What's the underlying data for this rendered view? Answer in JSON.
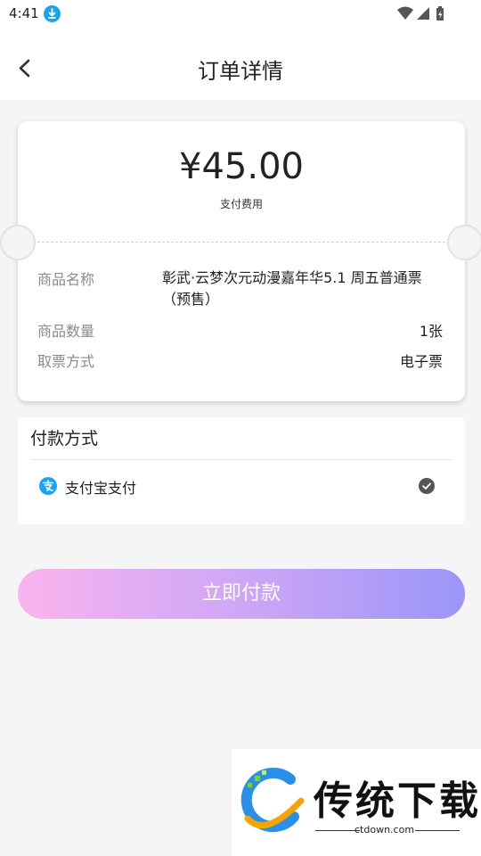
{
  "status_bar": {
    "time": "4:41"
  },
  "header": {
    "title": "订单详情"
  },
  "order": {
    "price": "¥45.00",
    "price_label": "支付费用",
    "rows": [
      {
        "label": "商品名称",
        "value": "彰武·云梦次元动漫嘉年华5.1 周五普通票（预售）"
      },
      {
        "label": "商品数量",
        "value": "1张"
      },
      {
        "label": "取票方式",
        "value": "电子票"
      }
    ]
  },
  "payment": {
    "title": "付款方式",
    "option_label": "支付宝支付",
    "option_icon_glyph": "支",
    "selected": true
  },
  "pay_button": {
    "label": "立即付款"
  },
  "watermark": {
    "name": "传统下载",
    "url": "ctdown.com"
  },
  "colors": {
    "button_gradient": [
      "#f9b4ee",
      "#cfa6f6",
      "#9a96f8"
    ],
    "alipay_blue": "#1aa3f5",
    "download_badge": "#1aa3e8"
  },
  "icons": {
    "status_left": "download-icon",
    "status_right": [
      "wifi-icon",
      "cell-signal-icon",
      "battery-icon"
    ],
    "header": "back-arrow-icon",
    "payment_option": "alipay-icon",
    "selected": "check-circle-icon"
  }
}
